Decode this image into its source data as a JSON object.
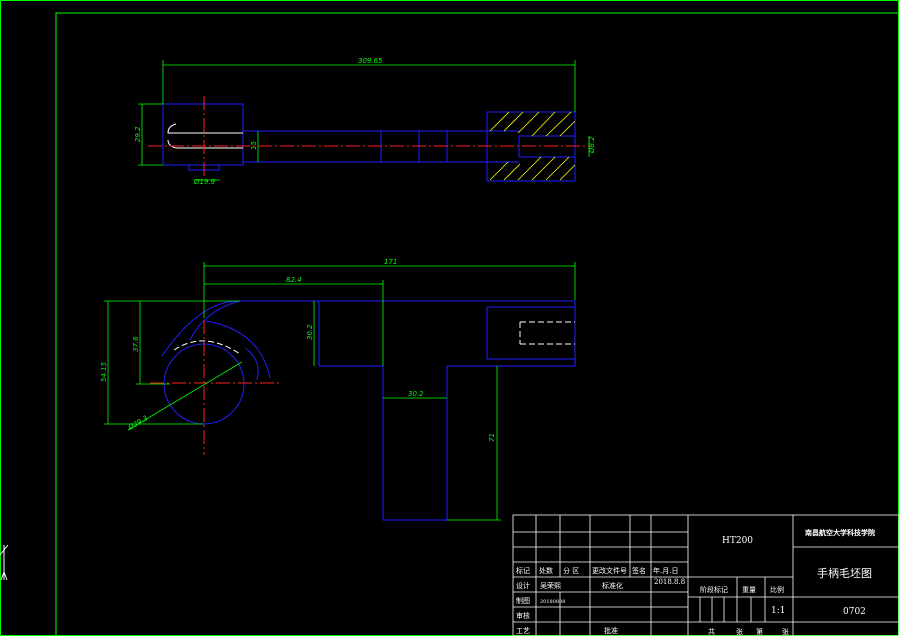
{
  "drawing": {
    "dimensions": {
      "overall_length_top": "309.65",
      "left_height_top": "29.2",
      "shaft_dia_top": "15",
      "bottom_dia_top": "Ø19.9",
      "right_dia_top": "Ø8.2",
      "overall_length_bottom": "171",
      "mid_length_bottom": "82.4",
      "left_total_height": "54.15",
      "left_inner_height": "37.6",
      "arm_height": "30.2",
      "stem_width": "30.2",
      "stem_height": "71",
      "circle_dia": "Ø39.3"
    }
  },
  "title_block": {
    "header_row": [
      "标记",
      "处数",
      "分 区",
      "更改文件号",
      "签名",
      "年.月.日"
    ],
    "row_design": [
      "设计",
      "吴荣熙",
      "20180808",
      "标准化",
      "",
      "2018.8.8"
    ],
    "row_draw": [
      "制图"
    ],
    "row_check": [
      "审核"
    ],
    "row_process": [
      "工艺",
      "",
      "",
      "批准"
    ],
    "material_code": "HT200",
    "school": "南昌航空大学科技学院",
    "drawing_title": "手柄毛坯图",
    "stage_label": "阶段标记",
    "weight_label": "重量",
    "scale_label": "比例",
    "scale_value": "1:1",
    "drawing_number": "0702",
    "sheet_row": [
      "共",
      "张",
      "第",
      "张"
    ]
  }
}
